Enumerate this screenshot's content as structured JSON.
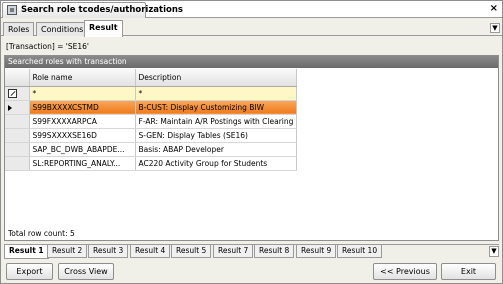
{
  "window": {
    "title": "Search role tcodes/authorizations",
    "close": "×"
  },
  "tabs": [
    {
      "label": "Roles"
    },
    {
      "label": "Conditions"
    },
    {
      "label": "Result"
    }
  ],
  "filter_text": "[Transaction] = 'SE16'",
  "grid": {
    "caption": "Searched roles with transaction",
    "columns": [
      "Role name",
      "Description"
    ],
    "filter_row": [
      "*",
      "*"
    ],
    "rows": [
      {
        "role": "S99BXXXXCSTMD",
        "desc": "B-CUST: Display Customizing BIW"
      },
      {
        "role": "S99FXXXXARPCA",
        "desc": "F-AR: Maintain A/R Postings with Clearing"
      },
      {
        "role": "S99SXXXXSE16D",
        "desc": "S-GEN: Display Tables (SE16)"
      },
      {
        "role": "SAP_BC_DWB_ABAPDE...",
        "desc": "Basis: ABAP Developer"
      },
      {
        "role": "SL:REPORTING_ANALY...",
        "desc": "AC220 Activity Group for Students"
      }
    ],
    "total": "Total row count: 5"
  },
  "result_tabs": [
    "Result 1",
    "Result 2",
    "Result 3",
    "Result 4",
    "Result 5",
    "Result 7",
    "Result 8",
    "Result 9",
    "Result 10"
  ],
  "buttons": {
    "export": "Export",
    "cross_view": "Cross View",
    "previous": "<< Previous",
    "exit": "Exit"
  },
  "colors": {
    "selected_row": "#ef7b1e",
    "filter_row": "#fff8c6",
    "panel_header": "#7a7a7a"
  }
}
